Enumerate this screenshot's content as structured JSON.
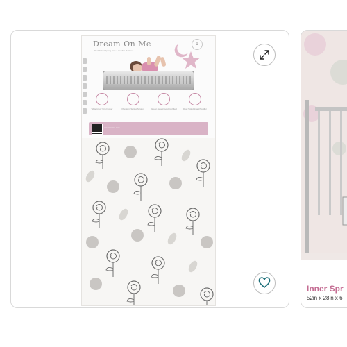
{
  "main_card": {
    "brand": "Dream On Me",
    "tagline": "Dual Sided Spring Crib & Toddler Mattress",
    "badge": "6",
    "features": [
      {
        "icon": "waterproof-icon",
        "text": "Waterproof Vinyl Cover"
      },
      {
        "icon": "spring-icon",
        "text": "Premium Spring System"
      },
      {
        "icon": "certified-icon",
        "text": "Green Guard Gold Certified"
      },
      {
        "icon": "dual-side-icon",
        "text": "Dual Sided Infant/Toddler"
      }
    ],
    "band_text": "dreamonme.com",
    "expand_icon": "expand-icon",
    "favorite_icon": "heart-icon"
  },
  "next_card": {
    "title": "Inner Spr",
    "subtitle": "52in x 28in x 6"
  },
  "colors": {
    "accent_pink": "#c46d93",
    "label_pink": "#d9b3c6",
    "border": "#d9d9d9"
  }
}
